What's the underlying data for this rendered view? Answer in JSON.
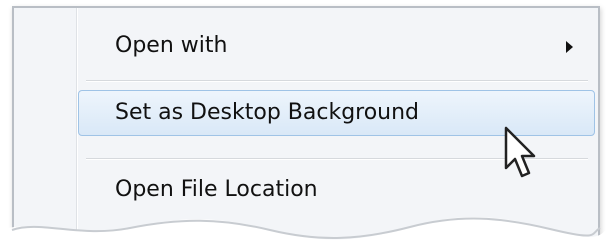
{
  "context_menu": {
    "items": [
      {
        "label": "Open with",
        "has_submenu": true,
        "highlighted": false
      },
      {
        "label": "Set as Desktop Background",
        "has_submenu": false,
        "highlighted": true
      },
      {
        "label": "Open File Location",
        "has_submenu": false,
        "highlighted": false
      }
    ]
  },
  "icons": {
    "submenu_arrow": "chevron-right-icon",
    "cursor": "mouse-pointer-icon"
  },
  "colors": {
    "menu_background": "#f3f5f8",
    "menu_border": "#b9bec5",
    "highlight_border": "#9fc3e6",
    "highlight_fill": "#d9e8f7",
    "text": "#111111"
  }
}
